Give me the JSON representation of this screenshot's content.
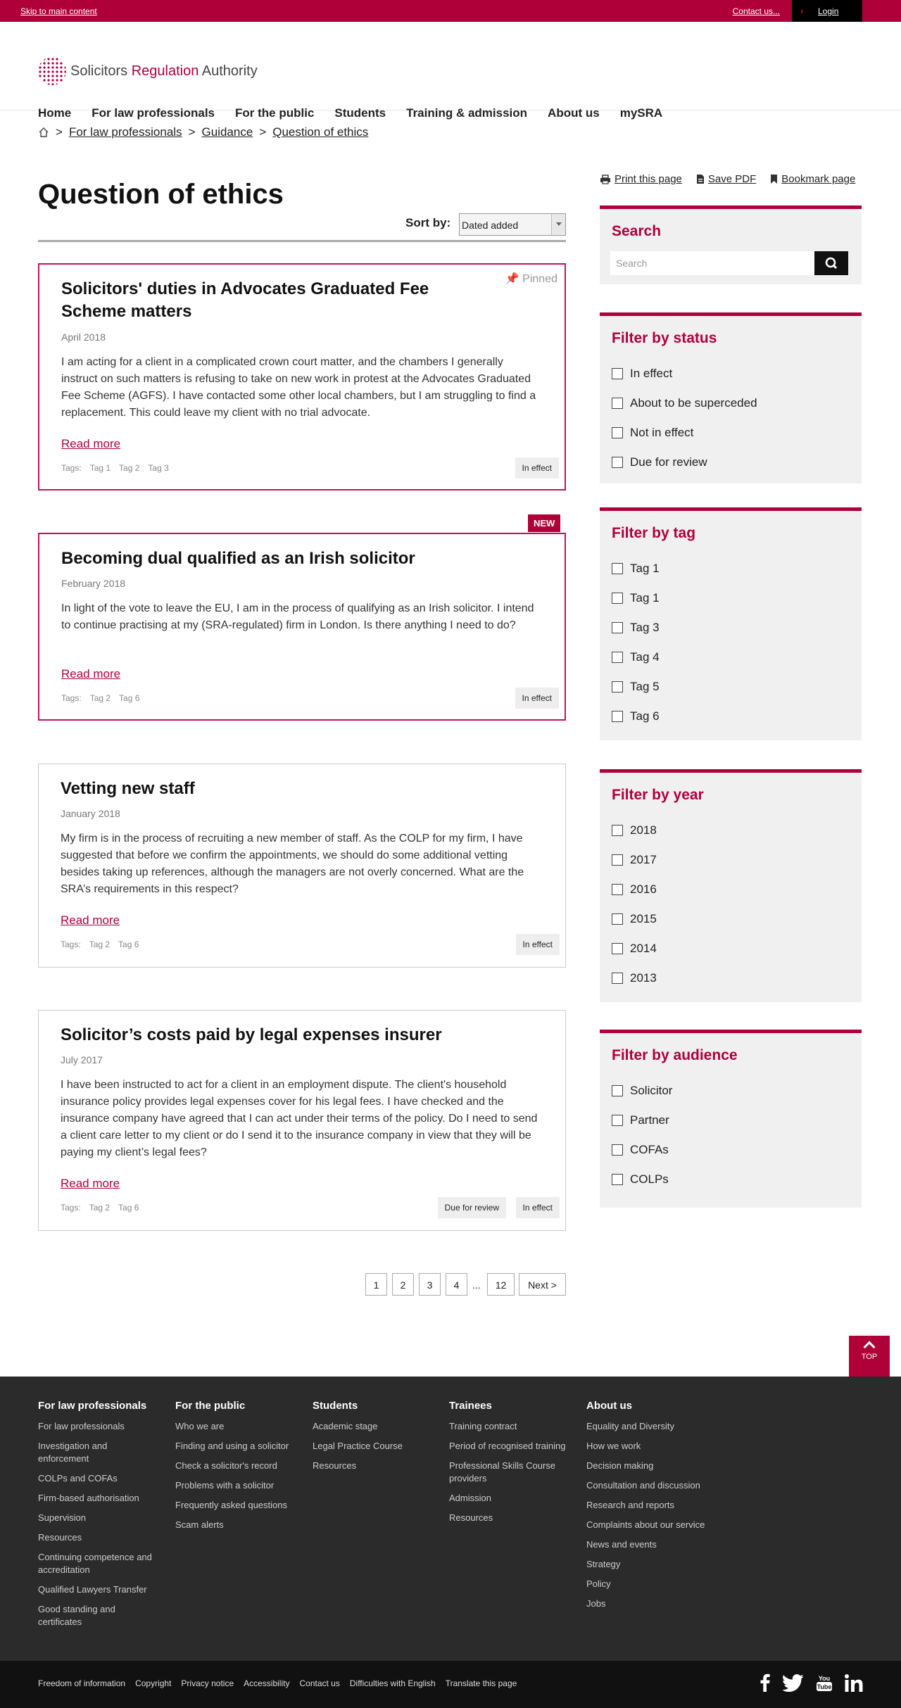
{
  "topbar": {
    "skip": "Skip to main content",
    "contact": "Contact us...",
    "login": "Login"
  },
  "logo": {
    "word1": "Solicitors",
    "word2": "Regulation",
    "word3": "Authority"
  },
  "nav": [
    "Home",
    "For law professionals",
    "For the public",
    "Students",
    "Training & admission",
    "About us",
    "mySRA"
  ],
  "breadcrumb": {
    "sep": ">",
    "items": [
      "For law professionals",
      "Guidance",
      "Question of ethics"
    ]
  },
  "page": {
    "title": "Question of ethics",
    "sort_label": "Sort by:",
    "sort_value": "Dated added"
  },
  "cards": [
    {
      "title": "Solicitors' duties in Advocates Graduated Fee Scheme matters",
      "date": "April 2018",
      "body": "I am acting for a client in a complicated crown court matter, and the chambers I generally instruct on such matters is refusing to take on new work in protest at the Advocates Graduated Fee Scheme (AGFS). I have contacted some other local chambers, but I am struggling to find a replacement. This could leave my client with no trial advocate.",
      "more": "Read more",
      "tags_label": "Tags:",
      "tags": [
        "Tag 1",
        "Tag 2",
        "Tag 3"
      ],
      "status": [
        "In effect"
      ],
      "pinned": "Pinned"
    },
    {
      "title": "Becoming dual qualified as an Irish solicitor",
      "date": "February 2018",
      "body": "In light of the vote to leave the EU, I am in the process of qualifying as an Irish solicitor. I intend to continue practising at my (SRA-regulated) firm in London. Is there anything I need to do?",
      "more": "Read more",
      "tags_label": "Tags:",
      "tags": [
        "Tag 2",
        "Tag 6"
      ],
      "status": [
        "In effect"
      ],
      "badge": "NEW"
    },
    {
      "title": "Vetting new staff",
      "date": "January 2018",
      "body": "My firm is in the process of recruiting a new member of staff. As the COLP for my firm, I have suggested that before we confirm the appointments, we should do some additional vetting besides taking up references, although the managers are not overly concerned. What are the SRA’s requirements in this respect?",
      "more": "Read more",
      "tags_label": "Tags:",
      "tags": [
        "Tag 2",
        "Tag 6"
      ],
      "status": [
        "In effect"
      ]
    },
    {
      "title": "Solicitor’s costs paid by legal expenses insurer",
      "date": "July 2017",
      "body": "I have been instructed to act for a client in an employment dispute. The client's household insurance policy provides legal expenses cover for his legal fees. I have checked and the insurance company have agreed that I can act under their terms of the policy. Do I need to send a client care letter to my client or do I send it to the insurance company in view that they will be paying my client’s legal fees?",
      "more": "Read more",
      "tags_label": "Tags:",
      "tags": [
        "Tag 2",
        "Tag 6"
      ],
      "status": [
        "Due for review",
        "In effect"
      ]
    }
  ],
  "pagination": {
    "pages": [
      "1",
      "2",
      "3",
      "4"
    ],
    "ellipsis": "...",
    "last": "12",
    "next": "Next >"
  },
  "tools": {
    "print": "Print this page",
    "pdf": "Save PDF",
    "bookmark": "Bookmark page"
  },
  "sidebar": {
    "search": {
      "title": "Search",
      "placeholder": "Search"
    },
    "status": {
      "title": "Filter by status",
      "options": [
        "In effect",
        "About to be superceded",
        "Not in effect",
        "Due for review"
      ]
    },
    "tag": {
      "title": "Filter by tag",
      "options": [
        "Tag 1",
        "Tag 1",
        "Tag 3",
        "Tag 4",
        "Tag 5",
        "Tag 6"
      ]
    },
    "year": {
      "title": "Filter by year",
      "options": [
        "2018",
        "2017",
        "2016",
        "2015",
        "2014",
        "2013"
      ]
    },
    "audience": {
      "title": "Filter by audience",
      "options": [
        "Solicitor",
        "Partner",
        "COFAs",
        "COLPs"
      ]
    }
  },
  "top_button": "TOP",
  "footer": {
    "columns": [
      {
        "title": "For law professionals",
        "links": [
          "For law professionals",
          "Investigation and enforcement",
          "COLPs and COFAs",
          "Firm-based authorisation",
          "Supervision",
          "Resources",
          "Continuing competence and accreditation",
          "Qualified Lawyers Transfer",
          "Good standing and certificates"
        ]
      },
      {
        "title": "For the public",
        "links": [
          "Who we are",
          "Finding and using a solicitor",
          "Check a solicitor's record",
          "Problems with a solicitor",
          "Frequently asked questions",
          "Scam alerts"
        ]
      },
      {
        "title": "Students",
        "links": [
          "Academic stage",
          "Legal Practice Course",
          "Resources"
        ]
      },
      {
        "title": "Trainees",
        "links": [
          "Training contract",
          "Period of recognised training",
          "Professional Skills Course providers",
          "Admission",
          "Resources"
        ]
      },
      {
        "title": "About us",
        "links": [
          "Equality and Diversity",
          "How we work",
          "Decision making",
          "Consultation and discussion",
          "Research and reports",
          "Complaints about our service",
          "News and events",
          "Strategy",
          "Policy",
          "Jobs"
        ]
      }
    ],
    "bottom_links": [
      "Freedom of information",
      "Copyright",
      "Privacy notice",
      "Accessibility",
      "Contact us",
      "Difficulties with English",
      "Translate this page"
    ],
    "social_icons": [
      "facebook-icon",
      "twitter-icon",
      "youtube-icon",
      "linkedin-icon"
    ]
  }
}
